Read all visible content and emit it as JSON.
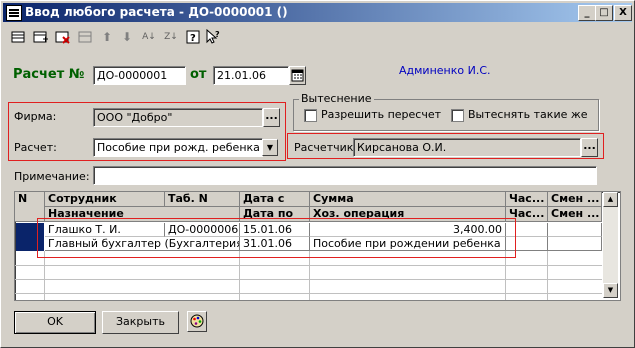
{
  "window": {
    "title": "Ввод любого расчета - ДО-0000001 ()"
  },
  "titlebar_buttons": [
    "_",
    "□",
    "X"
  ],
  "toolbar": {
    "icons": [
      "add-row-icon",
      "add-copy-icon",
      "delete-row-icon",
      "edit-row-icon",
      "move-up-icon",
      "move-down-icon",
      "sort-asc-icon",
      "sort-desc-icon",
      "help-icon",
      "context-help-icon"
    ]
  },
  "header": {
    "number_label": "Расчет №",
    "number_value": "ДО-0000001",
    "date_label": "от",
    "date_value": "21.01.06",
    "author": "Админенко И.С."
  },
  "firm": {
    "label": "Фирма:",
    "value": "ООО \"Добро\""
  },
  "calc": {
    "label": "Расчет:",
    "value": "Пособие при рожд. ребенка"
  },
  "displacement": {
    "title": "Вытеснение",
    "allow_recalc": "Разрешить пересчет",
    "displace_same": "Вытеснять такие же"
  },
  "calculator": {
    "label": "Расчетчик:",
    "value": "Кирсанова О.И."
  },
  "note": {
    "label": "Примечание:",
    "value": ""
  },
  "grid": {
    "headers_top": [
      "N",
      "Сотрудник",
      "Таб. N",
      "Дата с",
      "Сумма",
      "Час...",
      "Смен ..."
    ],
    "headers_bottom": [
      "",
      "Назначение",
      "",
      "Дата по",
      "Хоз. операция",
      "Час...",
      "Смен ..."
    ],
    "rows": [
      {
        "employee": "Глашко Т. И.",
        "tab": "ДО-0000006",
        "date_from": "15.01.06",
        "sum": "3,400.00"
      },
      {
        "employee": "Главный бухгалтер (Бухгалтерия)",
        "tab": "",
        "date_from": "31.01.06",
        "sum": "Пособие при рождении ребенка"
      }
    ]
  },
  "buttons": {
    "ok": "OK",
    "close": "Закрыть"
  }
}
